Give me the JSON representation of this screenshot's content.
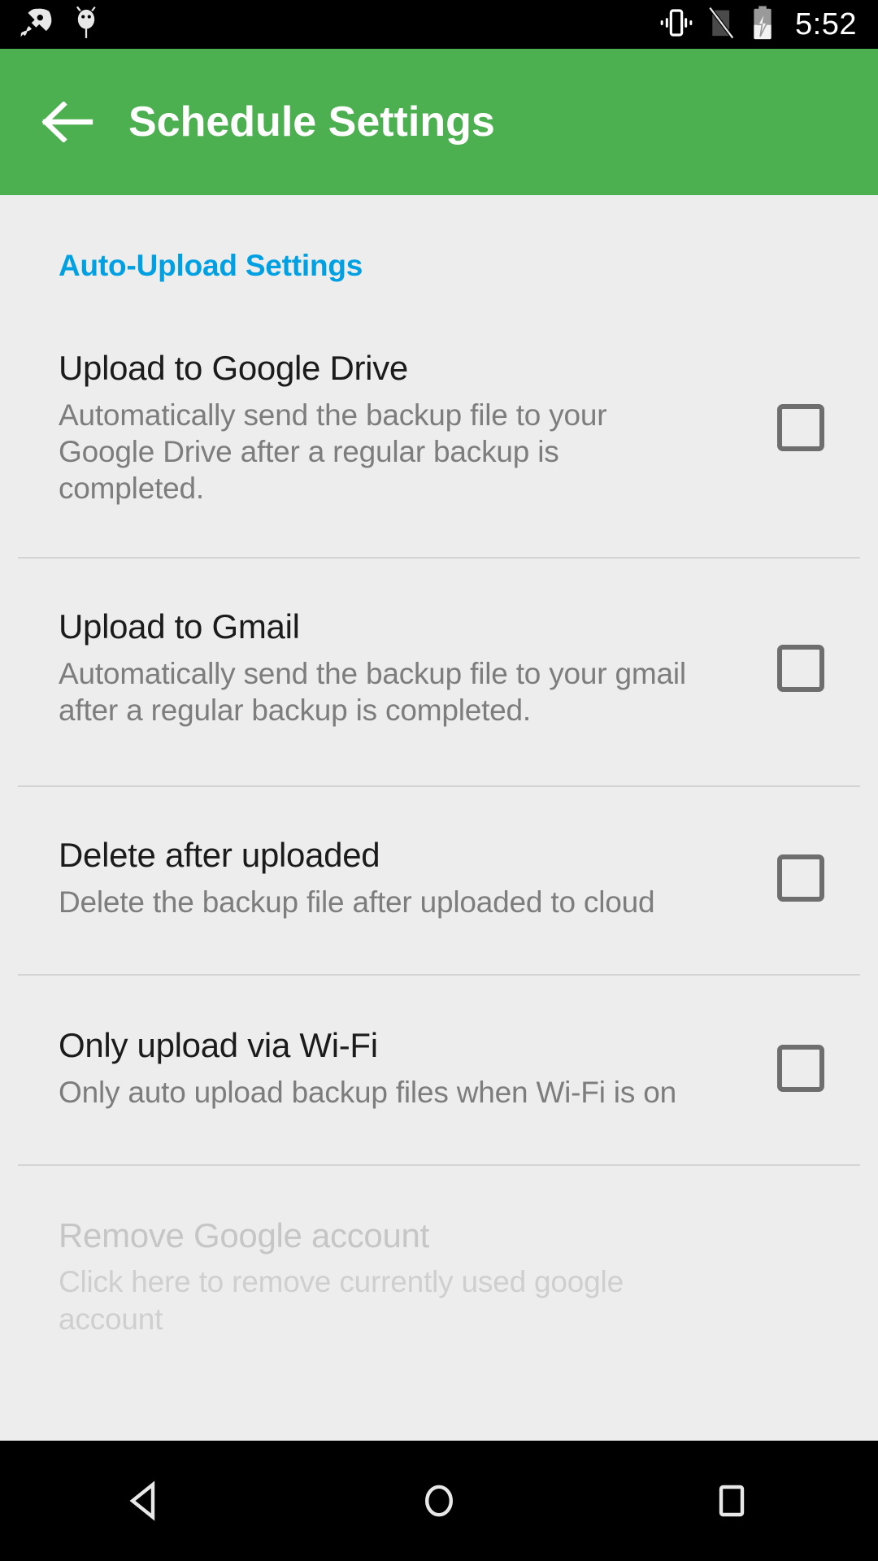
{
  "status_bar": {
    "icons": [
      {
        "name": "rocket-icon",
        "label": "rocket"
      },
      {
        "name": "android-bug-icon",
        "label": "android debug"
      },
      {
        "name": "vibrate-icon",
        "label": "vibrate"
      },
      {
        "name": "no-sim-icon",
        "label": "no sim"
      },
      {
        "name": "battery-charging-icon",
        "label": "battery charging"
      }
    ],
    "clock": "5:52"
  },
  "app_bar": {
    "back_label": "Back",
    "title": "Schedule Settings",
    "background_color": "#4CAF50",
    "title_color": "#FFFFFF"
  },
  "content": {
    "section_header": "Auto-Upload Settings",
    "section_header_color": "#00A0E3",
    "preferences": [
      {
        "id": "upload-to-google-drive",
        "title": "Upload to Google Drive",
        "summary": "Automatically send the backup file to your Google Drive after a regular backup is completed.",
        "control": "checkbox",
        "checked": false,
        "enabled": true
      },
      {
        "id": "upload-to-gmail",
        "title": "Upload to Gmail",
        "summary": "Automatically send the backup file to your gmail after a regular backup is completed.",
        "control": "checkbox",
        "checked": false,
        "enabled": true
      },
      {
        "id": "delete-after-uploaded",
        "title": "Delete after uploaded",
        "summary": "Delete the backup file after uploaded to cloud",
        "control": "checkbox",
        "checked": false,
        "enabled": true
      },
      {
        "id": "only-upload-via-wifi",
        "title": "Only upload via Wi-Fi",
        "summary": "Only auto upload backup files when Wi-Fi is on",
        "control": "checkbox",
        "checked": false,
        "enabled": true
      },
      {
        "id": "remove-google-account",
        "title": "Remove Google account",
        "summary": "Click here to remove currently used google account",
        "control": "none",
        "checked": false,
        "enabled": false
      }
    ]
  },
  "nav_bar": {
    "back_label": "Back",
    "home_label": "Home",
    "recents_label": "Recent apps"
  }
}
